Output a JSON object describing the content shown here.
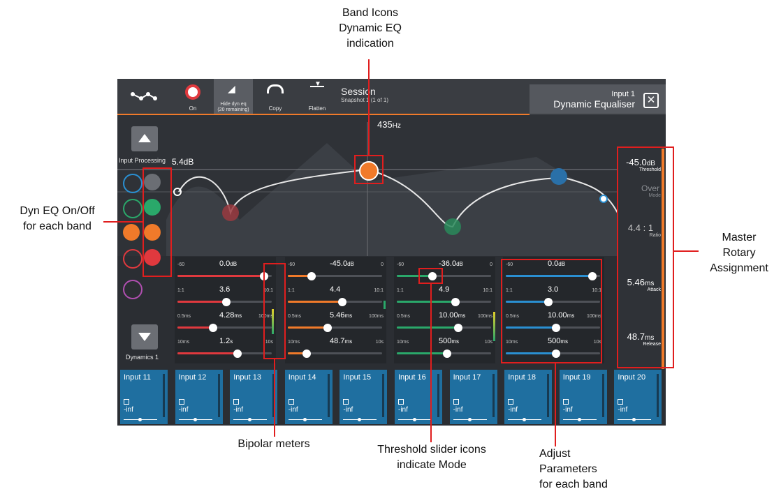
{
  "callouts": {
    "band_icons": [
      "Band Icons",
      "Dynamic EQ",
      "indication"
    ],
    "dyn_eq": [
      "Dyn EQ On/Off",
      "for each band"
    ],
    "master": [
      "Master",
      "Rotary",
      "Assignment"
    ],
    "bipolar": "Bipolar meters",
    "threshold": [
      "Threshold slider icons",
      "indicate Mode"
    ],
    "adjust": [
      "Adjust",
      "Parameters",
      "for each band"
    ]
  },
  "toolbar": {
    "on": "On",
    "hide_dyn": [
      "Hide dyn eq",
      "(20 remaining)"
    ],
    "copy": "Copy",
    "flatten": "Flatten"
  },
  "session": {
    "title": "Session",
    "snapshot": "Snapshot 1 (1 of 1)"
  },
  "header": {
    "input": "Input 1",
    "title": "Dynamic Equaliser",
    "close": "✕"
  },
  "graph": {
    "freq_value": "435",
    "freq_unit": "Hz",
    "gain": "5.4dB"
  },
  "left_nav": {
    "input_processing": "Input Processing",
    "dynamics": "Dynamics 1"
  },
  "rotary": {
    "threshold": {
      "value": "-45.0",
      "unit": "dB",
      "label": "Threshold"
    },
    "mode": {
      "value": "Over",
      "label": "Mode"
    },
    "ratio": {
      "value": "4.4 : 1",
      "label": "Ratio"
    },
    "attack": {
      "value": "5.46",
      "unit": "ms",
      "label": "Attack"
    },
    "release": {
      "value": "48.7",
      "unit": "ms",
      "label": "Release"
    }
  },
  "bands": [
    {
      "color": "#e0393e",
      "threshold": {
        "min": "-60",
        "val": "0.0",
        "unit": "dB",
        "max": "",
        "frac": 0.92
      },
      "ratio": {
        "min": "1:1",
        "val": "3.6",
        "max": "10:1",
        "frac": 0.52
      },
      "attack": {
        "min": "0.5ms",
        "val": "4.28",
        "unit": "ms",
        "max": "100ms",
        "frac": 0.38
      },
      "release": {
        "min": "10ms",
        "val": "1.2",
        "unit": "s",
        "max": "10s",
        "frac": 0.64
      }
    },
    {
      "color": "#f07a2a",
      "threshold": {
        "min": "-60",
        "val": "-45.0",
        "unit": "dB",
        "max": "0",
        "frac": 0.25
      },
      "ratio": {
        "min": "1:1",
        "val": "4.4",
        "max": "10:1",
        "frac": 0.58
      },
      "attack": {
        "min": "0.5ms",
        "val": "5.46",
        "unit": "ms",
        "max": "100ms",
        "frac": 0.42
      },
      "release": {
        "min": "10ms",
        "val": "48.7",
        "unit": "ms",
        "max": "10s",
        "frac": 0.2
      }
    },
    {
      "color": "#2aa86a",
      "threshold": {
        "min": "-60",
        "val": "-36.0",
        "unit": "dB",
        "max": "0",
        "frac": 0.38
      },
      "ratio": {
        "min": "1:1",
        "val": "4.9",
        "max": "10:1",
        "frac": 0.62
      },
      "attack": {
        "min": "0.5ms",
        "val": "10.00",
        "unit": "ms",
        "max": "100ms",
        "frac": 0.65
      },
      "release": {
        "min": "10ms",
        "val": "500",
        "unit": "ms",
        "max": "10s",
        "frac": 0.53
      }
    },
    {
      "color": "#2a8fd1",
      "threshold": {
        "min": "-60",
        "val": "0.0",
        "unit": "dB",
        "max": "",
        "frac": 0.92
      },
      "ratio": {
        "min": "1:1",
        "val": "3.0",
        "max": "10:1",
        "frac": 0.45
      },
      "attack": {
        "min": "0.5ms",
        "val": "10.00",
        "unit": "ms",
        "max": "100ms",
        "frac": 0.53
      },
      "release": {
        "min": "10ms",
        "val": "500",
        "unit": "ms",
        "max": "10s",
        "frac": 0.53
      }
    }
  ],
  "channels": [
    {
      "name": "Input 11",
      "level": "-inf"
    },
    {
      "name": "Input 12",
      "level": "-inf"
    },
    {
      "name": "Input 13",
      "level": "-inf"
    },
    {
      "name": "Input 14",
      "level": "-inf"
    },
    {
      "name": "Input 15",
      "level": "-inf"
    },
    {
      "name": "Input 16",
      "level": "-inf"
    },
    {
      "name": "Input 17",
      "level": "-inf"
    },
    {
      "name": "Input 18",
      "level": "-inf"
    },
    {
      "name": "Input 19",
      "level": "-inf"
    },
    {
      "name": "Input 20",
      "level": "-inf"
    }
  ]
}
